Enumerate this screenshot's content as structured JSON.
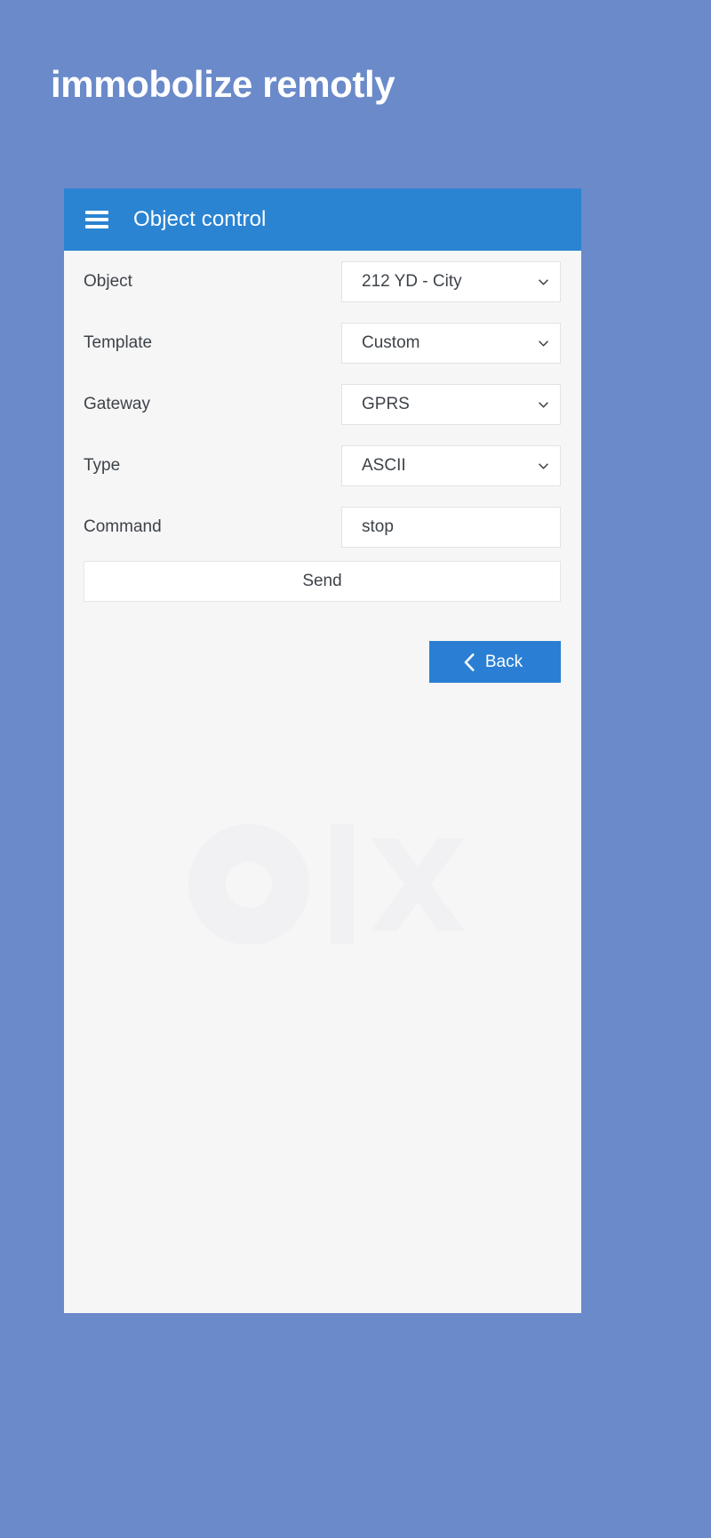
{
  "page": {
    "heading": "immobolize remotly",
    "background_color": "#6a8aca"
  },
  "appbar": {
    "menu_icon": "hamburger-menu-icon",
    "title": "Object control",
    "background_color": "#2a84d2"
  },
  "form": {
    "fields": [
      {
        "label": "Object",
        "type": "select",
        "value": "212 YD - City",
        "icon": "chevron-down-icon"
      },
      {
        "label": "Template",
        "type": "select",
        "value": "Custom",
        "icon": "chevron-down-icon"
      },
      {
        "label": "Gateway",
        "type": "select",
        "value": "GPRS",
        "icon": "chevron-down-icon"
      },
      {
        "label": "Type",
        "type": "select",
        "value": "ASCII",
        "icon": "chevron-down-icon"
      },
      {
        "label": "Command",
        "type": "text",
        "value": "stop",
        "placeholder": "",
        "icon": ""
      }
    ],
    "send_label": "Send"
  },
  "footer": {
    "back_label": "Back",
    "back_icon": "chevron-left-icon",
    "back_color": "#2a7fd4"
  }
}
